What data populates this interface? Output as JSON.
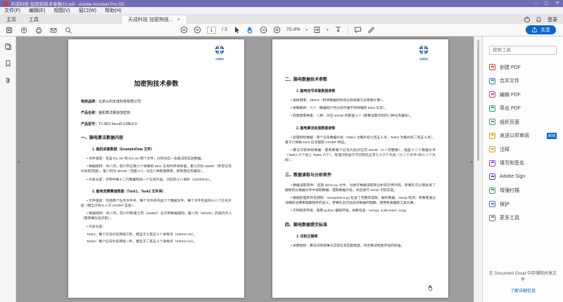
{
  "window": {
    "title": "天成科技 加密狗技术参数22.pdf - Adobe Acrobat Pro DC",
    "controls": {
      "minimize": "–",
      "maximize": "▢",
      "close": "✕"
    }
  },
  "menubar": {
    "items": [
      "文件(F)",
      "编辑(E)",
      "视图(V)",
      "窗口(W)",
      "帮助(H)"
    ]
  },
  "tabs": {
    "home": "主页",
    "tools": "工具",
    "doc": "天成科技 加密狗技...",
    "close": "×"
  },
  "account": {
    "login": "登录"
  },
  "toolbar": {
    "page_current": "1",
    "page_total": "/ 3",
    "zoom": "70.4%",
    "share": "共享"
  },
  "tools_panel": {
    "search_placeholder": "搜索工具",
    "items": [
      {
        "name": "create-pdf",
        "label": "创建 PDF",
        "color": "#dd3e2b"
      },
      {
        "name": "combine-files",
        "label": "合并文件",
        "color": "#3b6fd4"
      },
      {
        "name": "edit-pdf",
        "label": "编辑 PDF",
        "color": "#d6399f"
      },
      {
        "name": "export-pdf",
        "label": "导出 PDF",
        "color": "#2d9d78"
      },
      {
        "name": "organize-pages",
        "label": "组织页面",
        "color": "#3f9e63"
      },
      {
        "name": "send-for-review",
        "label": "发送以供审阅",
        "color": "#d9a600",
        "badge": "新增"
      },
      {
        "name": "comment",
        "label": "注释",
        "color": "#e5a02c"
      },
      {
        "name": "fill-sign",
        "label": "填写和签名",
        "color": "#8a4bd0"
      },
      {
        "name": "adobe-sign",
        "label": "Adobe Sign",
        "color": "#5d3ab5"
      },
      {
        "name": "enhance-scans",
        "label": "增强扫描",
        "color": "#3f9e63"
      },
      {
        "name": "protect",
        "label": "保护",
        "color": "#5c6bc0"
      },
      {
        "name": "more-tools",
        "label": "更多工具",
        "color": "#777777"
      }
    ],
    "footer": "在 Document Cloud 中存储和共享文件",
    "footer_link": "了解详细信息"
  },
  "document": {
    "logo_text": "天成科技",
    "page1": {
      "lines": [
        {
          "cls": "t-title",
          "t": "加密狗技术参数"
        },
        {
          "cls": "t-meta",
          "t": "物资品牌：",
          "v": "北京以利天成科技有限公司"
        },
        {
          "cls": "t-meta",
          "t": "产品名称：",
          "v": "脑机算法赛道加密狗"
        },
        {
          "cls": "t-meta",
          "t": "产品型号：",
          "v": "TC-BCI-SecuD-USBv2.0"
        },
        {
          "cls": "t-h1",
          "t": "一、脑电算法数据内容"
        },
        {
          "cls": "t-h2",
          "t": "1.  脑机采集数据（ExampleData 文件）"
        },
        {
          "cls": "t-b",
          "t": "• 文件组成：包含 D1.csv 和 D2.csv 两个文件，分别对应一名被试的实验数据。"
        },
        {
          "cls": "t-b",
          "t": "• 数据结构：共八列，前六列记录六个导联的 EEG 信号时序采样值，第七列为 taskID（界定信号片段的范围），第八列为 stimID（范围 0-7，对应八种刺激频率，即刺激任务编号）。"
        },
        {
          "cls": "t-b",
          "t": "• 片段长度：示例中每十二行数据构成一个信号片段，对应四十八毫秒（12/250Hz）。"
        },
        {
          "cls": "t-h2",
          "t": "2.  脑电竞赛赛道数据（Task1、Task2 文件夹）"
        },
        {
          "cls": "t-b",
          "t": "• 文件组成：包括两个任务文件夹，每个文件夹内含六个数据文件，每个文件包含四十八个信号片段（相当于四十八次 SSVEP 实验）。"
        },
        {
          "cls": "t-b",
          "t": "• 数据结构：共八列，前六列和第七列（taskID）与示例数据相同，第八列（stimID）的值均为-1（需参赛队伍识别）。"
        },
        {
          "cls": "t-b",
          "t": "• 片段长度："
        },
        {
          "cls": "t-p",
          "t": "Task1：每个信号片段持续三秒，相当于七百五十个采样点（250Hz×3s）。"
        },
        {
          "cls": "t-p",
          "t": "Task2：每个信号片段持续一秒，相当于二百五十个采样点（250Hz×1s）。"
        }
      ]
    },
    "page2": {
      "lines": [
        {
          "cls": "t-h1",
          "t": "二、脑电数据技术参数"
        },
        {
          "cls": "t-h2",
          "t": "1.  脑电信号采集数据参数"
        },
        {
          "cls": "t-b",
          "t": "• 采样频率：250Hz（时序数据的时间分辨率基于此参数计算）。"
        },
        {
          "cls": "t-b",
          "t": "• 导联数目：六个（数据前六列分别代表不同导联的 EEG 信号）。"
        },
        {
          "cls": "t-b",
          "t": "• 刺激频率种类：八种，对应 stimID 的取值 0-7（即算法需识别的八种任务编号）。"
        },
        {
          "cls": "t-h2",
          "t": "2.  脑电算法处理数据参数"
        },
        {
          "cls": "t-b",
          "t": "• 处理目标数据：单个信号数据片段（Task1 为每片段七百五十点，Task2 为每片段二百五十点），基于六导联 EEG 信号提取 SSVEP 特征。"
        },
        {
          "cls": "t-b",
          "t": "• 算法识别目标数据：需判断每个信号片段对应的 stimID（0-7 的整数），涵盖十二个数据文件（Task1 六个加上 Task2 六个），处理识别总计可识别出五百七十六个片段（十二个文件×四十八个片段）。"
        },
        {
          "cls": "t-h1",
          "t": "三、数据读取与分析软件"
        },
        {
          "cls": "t-b",
          "t": "• 数据读取软件：包括 demo.py 文件，为进行数据读取和分析的示例代码，参赛队可以借此来了解如何从数据文件中读取数据、提取数据片段，并且进行 ssvep 识别实验。"
        },
        {
          "cls": "t-b",
          "t": "• 数据处理软件包源码：ssvepdetect.py 包含了完整的读取、解析数据、ssvep 检测，参赛者通过详细的注释来理解程序的含义，参赛队员可加深对数据的理解，使用各类编程工具比赛。"
        },
        {
          "cls": "t-b",
          "t": "• 示例程序环境：使用 python 编程环境，依赖包含：numpy, scikit-learn, scipy"
        },
        {
          "cls": "t-h1",
          "t": "四、脑电数据提交标准"
        },
        {
          "cls": "t-h2",
          "t": "1.  识别正确率"
        },
        {
          "cls": "t-b",
          "t": "• 关键指标：算法识别结果与实际信号匹配程度，符合算法性能评估的标准。"
        }
      ]
    }
  }
}
